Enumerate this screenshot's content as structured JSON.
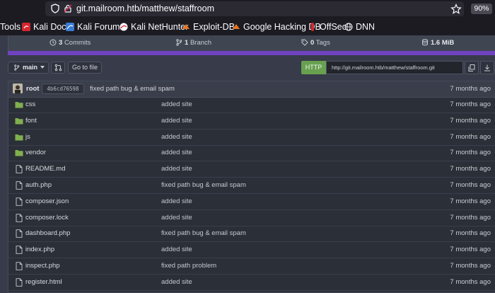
{
  "browser": {
    "url": "git.mailroom.htb/matthew/staffroom",
    "zoom": "90%",
    "bookmarks": [
      {
        "label": "Tools",
        "icon": "none"
      },
      {
        "label": "Kali Docs",
        "icon": "kali-docs-icon"
      },
      {
        "label": "Kali Forums",
        "icon": "kali-forums-icon"
      },
      {
        "label": "Kali NetHunter",
        "icon": "nethunter-icon"
      },
      {
        "label": "Exploit-DB",
        "icon": "exploitdb-icon"
      },
      {
        "label": "Google Hacking DB",
        "icon": "ghdb-icon"
      },
      {
        "label": "OffSec",
        "icon": "offsec-icon"
      },
      {
        "label": "DNN",
        "icon": "globe-icon"
      }
    ]
  },
  "repo": {
    "stats": {
      "commits_count": "3",
      "commits_label": "Commits",
      "branches_count": "1",
      "branches_label": "Branch",
      "tags_count": "0",
      "tags_label": "Tags",
      "size": "1.6 MiB"
    },
    "language_bar_color": "#6f42c1",
    "branch": "main",
    "go_to_file": "Go to file",
    "clone": {
      "protocol": "HTTP",
      "url": "http://git.mailroom.htb/matthew/staffroom.git"
    },
    "latest_commit": {
      "author": "root",
      "sha": "4b6cd76598",
      "message": "fixed path bug & email spam",
      "time": "7 months ago"
    },
    "files": [
      {
        "name": "css",
        "type": "dir",
        "message": "added site",
        "time": "7 months ago"
      },
      {
        "name": "font",
        "type": "dir",
        "message": "added site",
        "time": "7 months ago"
      },
      {
        "name": "js",
        "type": "dir",
        "message": "added site",
        "time": "7 months ago"
      },
      {
        "name": "vendor",
        "type": "dir",
        "message": "added site",
        "time": "7 months ago"
      },
      {
        "name": "README.md",
        "type": "file",
        "message": "added site",
        "time": "7 months ago"
      },
      {
        "name": "auth.php",
        "type": "file",
        "message": "fixed path bug & email spam",
        "time": "7 months ago"
      },
      {
        "name": "composer.json",
        "type": "file",
        "message": "added site",
        "time": "7 months ago"
      },
      {
        "name": "composer.lock",
        "type": "file",
        "message": "added site",
        "time": "7 months ago"
      },
      {
        "name": "dashboard.php",
        "type": "file",
        "message": "fixed path bug & email spam",
        "time": "7 months ago"
      },
      {
        "name": "index.php",
        "type": "file",
        "message": "added site",
        "time": "7 months ago"
      },
      {
        "name": "inspect.php",
        "type": "file",
        "message": "fixed path problem",
        "time": "7 months ago"
      },
      {
        "name": "register.html",
        "type": "file",
        "message": "added site",
        "time": "7 months ago"
      }
    ]
  },
  "colors": {
    "folder": "#7fb04e",
    "http_button": "#68a050"
  }
}
